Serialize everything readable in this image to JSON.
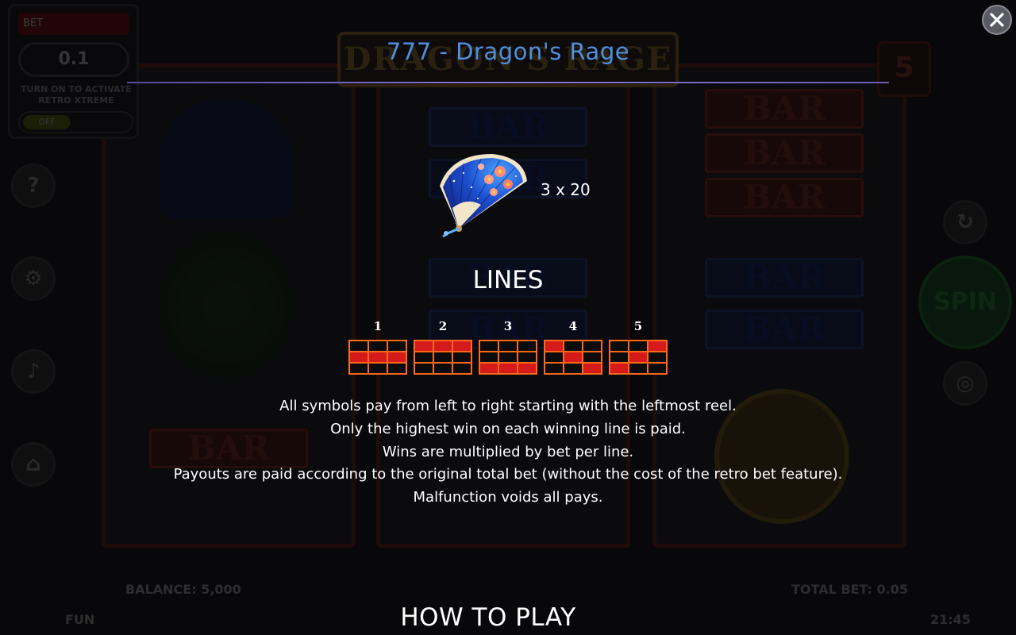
{
  "background": {
    "game_logo": "DRAGON'S RAGE",
    "bet_label": "BET",
    "bet_value": "0.1",
    "retro_text": "TURN ON TO ACTIVATE RETRO XTREME",
    "toggle_label": "OFF",
    "lines_count": "5",
    "spin_label": "SPIN",
    "balance": "BALANCE: 5,000",
    "total_bet": "TOTAL BET: 0.05",
    "mode": "FUN",
    "clock": "21:45",
    "bar_label": "BAR"
  },
  "modal": {
    "title": "777 - Dragon's Rage",
    "close_icon": "close-icon",
    "symbol": {
      "icon": "hand-fan-icon",
      "payout": "3 x 20"
    },
    "lines_heading": "LINES",
    "lines": [
      {
        "number": "1",
        "pattern": [
          [
            0,
            0,
            0
          ],
          [
            1,
            1,
            1
          ],
          [
            0,
            0,
            0
          ]
        ]
      },
      {
        "number": "2",
        "pattern": [
          [
            1,
            1,
            1
          ],
          [
            0,
            0,
            0
          ],
          [
            0,
            0,
            0
          ]
        ]
      },
      {
        "number": "3",
        "pattern": [
          [
            0,
            0,
            0
          ],
          [
            0,
            0,
            0
          ],
          [
            1,
            1,
            1
          ]
        ]
      },
      {
        "number": "4",
        "pattern": [
          [
            1,
            0,
            0
          ],
          [
            0,
            1,
            0
          ],
          [
            0,
            0,
            1
          ]
        ]
      },
      {
        "number": "5",
        "pattern": [
          [
            0,
            0,
            1
          ],
          [
            0,
            1,
            0
          ],
          [
            1,
            0,
            0
          ]
        ]
      }
    ],
    "rules": [
      "All symbols pay from left to right starting with the leftmost reel.",
      "Only the highest win on each winning line is paid.",
      "Wins are multiplied by bet per line.",
      "Payouts are paid according to the original total bet (without the cost of the retro bet feature).",
      "Malfunction voids all pays."
    ],
    "footer_title": "HOW TO PLAY"
  }
}
